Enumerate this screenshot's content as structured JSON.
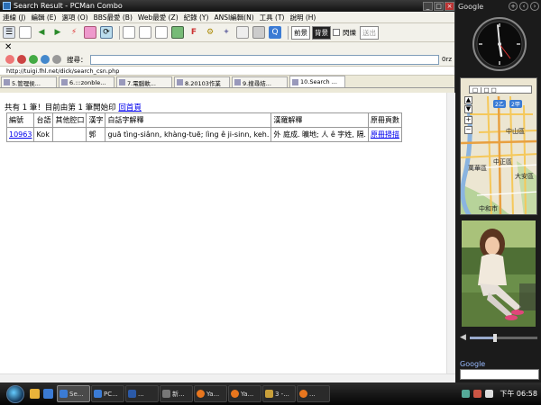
{
  "window": {
    "title": "Search Result - PCMan Combo"
  },
  "menu": {
    "items": [
      "連線 (J)",
      "編輯 (E)",
      "選項 (O)",
      "BBS最愛 (B)",
      "Web最愛 (Z)",
      "紀錄 (Y)",
      "ANSI編輯(N)",
      "工具 (T)",
      "說明 (H)"
    ]
  },
  "toolbar": {
    "labels": [
      "前景",
      "背景",
      "閃爍",
      "送出"
    ]
  },
  "search": {
    "label": "搜尋：",
    "orz": "0rz"
  },
  "address": {
    "url": "http://tuigi.fhl.net/dick/search_csn.php"
  },
  "tabs": [
    {
      "label": "5.管理侯..."
    },
    {
      "label": "6.:::zonble..."
    },
    {
      "label": "7.電腦軟..."
    },
    {
      "label": "8.20103作業"
    },
    {
      "label": "9.搜尋結..."
    },
    {
      "label": "10.Search ..."
    }
  ],
  "result": {
    "summary": "共有 1 筆！目前由第 1 筆開始印",
    "home_link": "回首頁",
    "headers": [
      "編號",
      "台語",
      "其他腔口",
      "漢字",
      "白話字解釋",
      "漢羅解釋",
      "原冊頁數"
    ],
    "rows": [
      {
        "id": "10963",
        "taigi": "Kok",
        "other": "",
        "hanji": "郭",
        "poj": "guā tìng-siânn, khàng-tuē; lìng ê ji-sinn, keh.",
        "hanlo": "外 庭成. 曠地; 人 ê 字姓, 隔.",
        "page": "原冊掃描"
      }
    ]
  },
  "sidebar": {
    "google_logo": "Google",
    "map_select": "□ | □ □",
    "map_places": [
      "中山區",
      "萬華區",
      "中正區",
      "大安區",
      "中和市"
    ],
    "map_shields": [
      "2乙",
      "2甲"
    ],
    "volume_percent": 35,
    "google_search_label": "Google"
  },
  "taskbar": {
    "items": [
      {
        "label": "Se..."
      },
      {
        "label": "PC..."
      },
      {
        "label": "..."
      },
      {
        "label": "新..."
      },
      {
        "label": "Ya..."
      },
      {
        "label": "Ya..."
      },
      {
        "label": "3 -..."
      },
      {
        "label": "..."
      }
    ],
    "clock": "下午 06:58"
  }
}
